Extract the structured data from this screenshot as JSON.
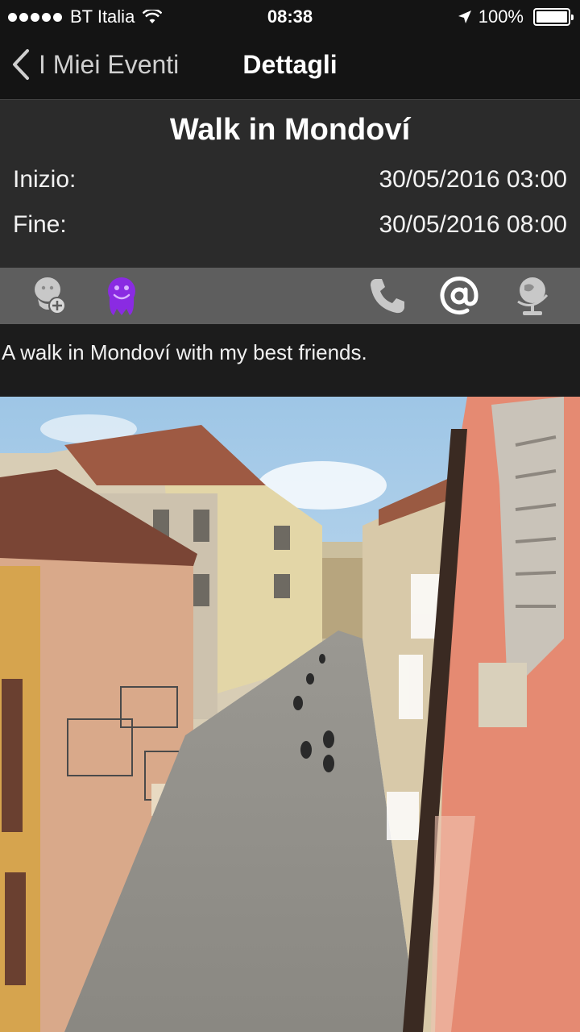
{
  "status_bar": {
    "carrier": "BT Italia",
    "time": "08:38",
    "battery": "100%",
    "battery_level": 1.0
  },
  "nav": {
    "back_label": "I Miei Eventi",
    "title": "Dettagli"
  },
  "event": {
    "title": "Walk in Mondoví",
    "start_label": "Inizio:",
    "start_value": "30/05/2016 03:00",
    "end_label": "Fine:",
    "end_value": "30/05/2016 08:00",
    "description": "A walk in Mondoví with my best friends."
  },
  "actions": {
    "icons": [
      "add-person-icon",
      "participant-avatar-icon",
      "phone-icon",
      "email-icon",
      "globe-icon"
    ]
  },
  "colors": {
    "bar": "#141414",
    "header": "#2b2b2b",
    "action_bar": "#5e5e5e",
    "avatar_purple": "#8a2be2"
  }
}
